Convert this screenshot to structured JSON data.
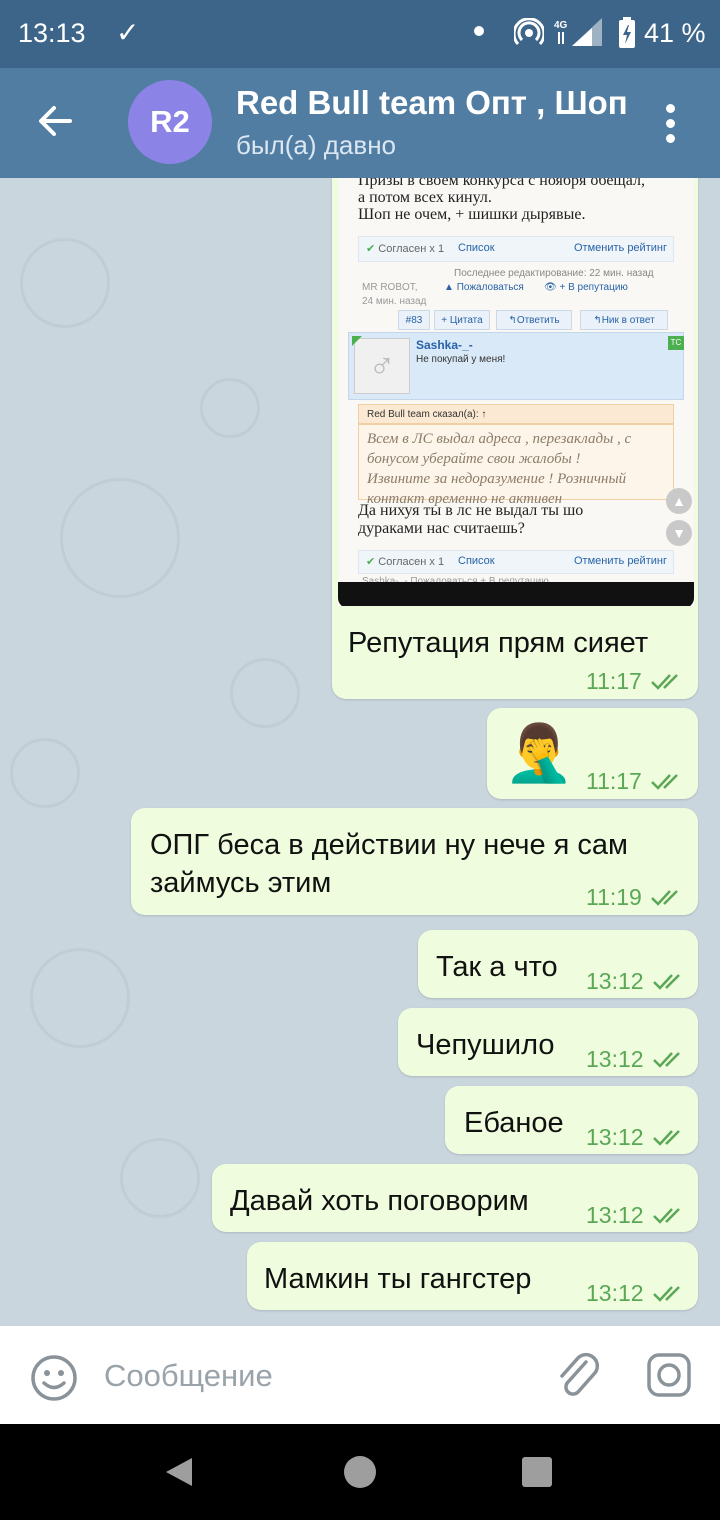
{
  "status_bar": {
    "time": "13:13",
    "battery": "41 %",
    "network": "4G"
  },
  "header": {
    "avatar_initials": "R2",
    "title": "Red Bull team Опт , Шоп",
    "subtitle": "был(а) давно"
  },
  "screenshot": {
    "post_text": [
      "Призы в своем конкурса с ноября обещал,",
      "а потом всех кинул.",
      "Шоп не очем, + шишки дырявые."
    ],
    "agree": "Согласен x 1",
    "list": "Список",
    "cancel_rating": "Отменить рейтинг",
    "last_edit": "Последнее редактирование: 22 мин. назад",
    "author": "MR ROBOT,",
    "author_time": "24 мин. назад",
    "report": "Пожаловаться",
    "reputation": "+ В репутацию",
    "post_number": "#83",
    "quote_btn": "+ Цитата",
    "reply_btn": "Ответить",
    "nick_btn": "Ник в ответ",
    "user": "Sashka-_-",
    "user_status": "Не покупай у меня!",
    "tc_badge": "TC",
    "quote_header": "Red Bull team сказал(а): ↑",
    "quote_text": [
      "Всем в ЛС выдал адреса , перезаклады , с",
      "бонусом уберайте свои жалобы !",
      "Извините за недоразумение ! Розничный",
      "контакт временно не активен"
    ],
    "reply_text": [
      "Да нихуя ты в лс не выдал ты шо",
      "дураками нас считаешь?"
    ],
    "agree2": "Согласен x 1",
    "list2": "Список",
    "cancel_rating2": "Отменить рейтинг",
    "footer_cut": "Sashka-_-   Пожаловаться   + В репутацию"
  },
  "messages": [
    {
      "text": "Репутация прям сияет",
      "time": "11:17"
    },
    {
      "emoji": "🤦‍♂️",
      "time": "11:17"
    },
    {
      "text": "ОПГ беса в действии ну нече я сам займусь этим",
      "line1": "ОПГ беса в действии ну нече я сам",
      "line2": "займусь этим",
      "time": "11:19"
    },
    {
      "text": "Так а что",
      "time": "13:12"
    },
    {
      "text": "Чепушило",
      "time": "13:12"
    },
    {
      "text": "Ебаное",
      "time": "13:12"
    },
    {
      "text": "Давай хоть поговорим",
      "time": "13:12"
    },
    {
      "text": "Мамкин ты гангстер",
      "time": "13:12"
    }
  ],
  "input": {
    "placeholder": "Сообщение"
  },
  "colors": {
    "header": "#517da2",
    "status_bar": "#3d6589",
    "bubble": "#effdde",
    "tick": "#5ba756",
    "avatar": "#8b84e6"
  }
}
